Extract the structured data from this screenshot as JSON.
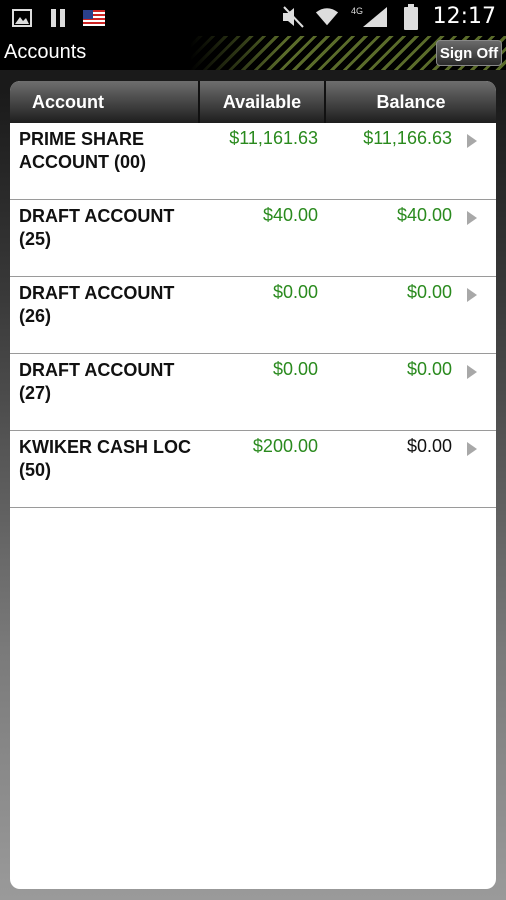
{
  "status_bar": {
    "time": "12:17",
    "network": "4G",
    "left_icons": [
      "image-icon",
      "pause-icon",
      "us-flag-icon"
    ],
    "right_icons": [
      "mute-icon",
      "wifi-icon",
      "signal-icon",
      "battery-icon"
    ]
  },
  "title_bar": {
    "title": "Accounts",
    "sign_off_label": "Sign Off"
  },
  "table": {
    "headers": [
      "Account",
      "Available",
      "Balance"
    ],
    "rows": [
      {
        "account_line1": "PRIME SHARE",
        "account_line2": "ACCOUNT (00)",
        "available": "$11,161.63",
        "balance": "$11,166.63",
        "balance_color": "#2a8a1e"
      },
      {
        "account_line1": "DRAFT ACCOUNT",
        "account_line2": "(25)",
        "available": "$40.00",
        "balance": "$40.00",
        "balance_color": "#2a8a1e"
      },
      {
        "account_line1": "DRAFT ACCOUNT",
        "account_line2": "(26)",
        "available": "$0.00",
        "balance": "$0.00",
        "balance_color": "#2a8a1e"
      },
      {
        "account_line1": "DRAFT ACCOUNT",
        "account_line2": "(27)",
        "available": "$0.00",
        "balance": "$0.00",
        "balance_color": "#2a8a1e"
      },
      {
        "account_line1": "KWIKER CASH LOC",
        "account_line2": "(50)",
        "available": "$200.00",
        "balance": "$0.00",
        "balance_color": "#111111"
      }
    ]
  },
  "colors": {
    "positive_green": "#2a8a1e",
    "header_dark": "#1e1e1e",
    "stripe_olive": "#5a6b2a"
  }
}
